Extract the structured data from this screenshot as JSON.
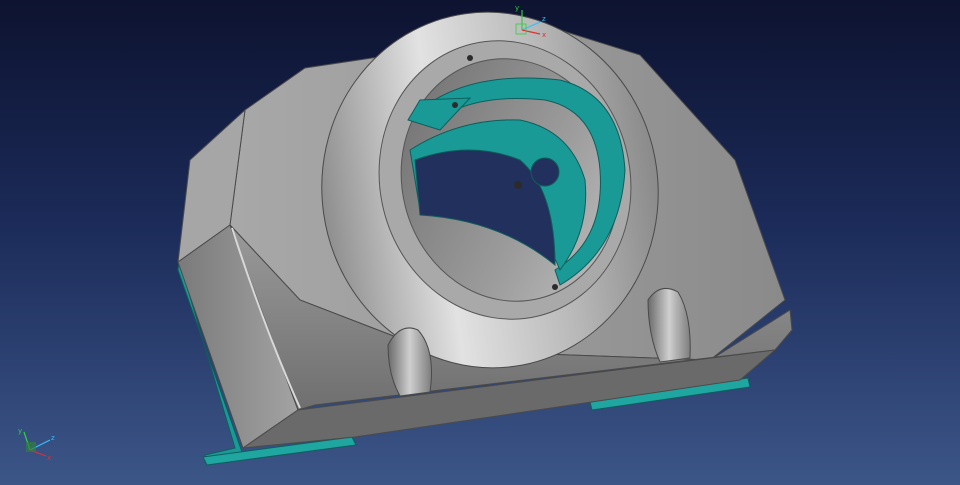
{
  "viewer": {
    "background_top": "#0d1330",
    "background_bottom": "#3c5688",
    "part_color": "#8c8c8c",
    "part_shadow": "#5f5f5f",
    "part_highlight": "#d4d4d4",
    "accent_color": "#1a9a96"
  },
  "axis_triad": {
    "x_label": "x",
    "y_label": "y",
    "z_label": "z",
    "x_color": "#e03030",
    "y_color": "#30d040",
    "z_color": "#30c0ff"
  },
  "icons": [
    "triad-top-icon",
    "triad-corner-icon"
  ]
}
